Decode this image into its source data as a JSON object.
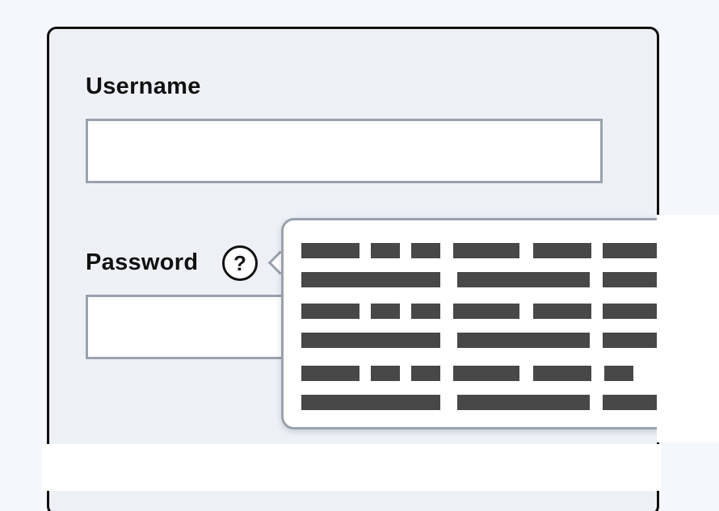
{
  "form": {
    "username": {
      "label": "Username",
      "value": "",
      "placeholder": ""
    },
    "password": {
      "label": "Password",
      "value": "",
      "placeholder": ""
    },
    "help_button": {
      "glyph": "?",
      "icon": "question-circle-icon"
    }
  },
  "tooltip": {
    "content": "redacted placeholder text"
  },
  "colors": {
    "page_background": "#f4f7fb",
    "card_background": "#edf1f6",
    "card_border": "#111111",
    "input_border": "#9aa1ad",
    "placeholder_bar": "#484848"
  }
}
